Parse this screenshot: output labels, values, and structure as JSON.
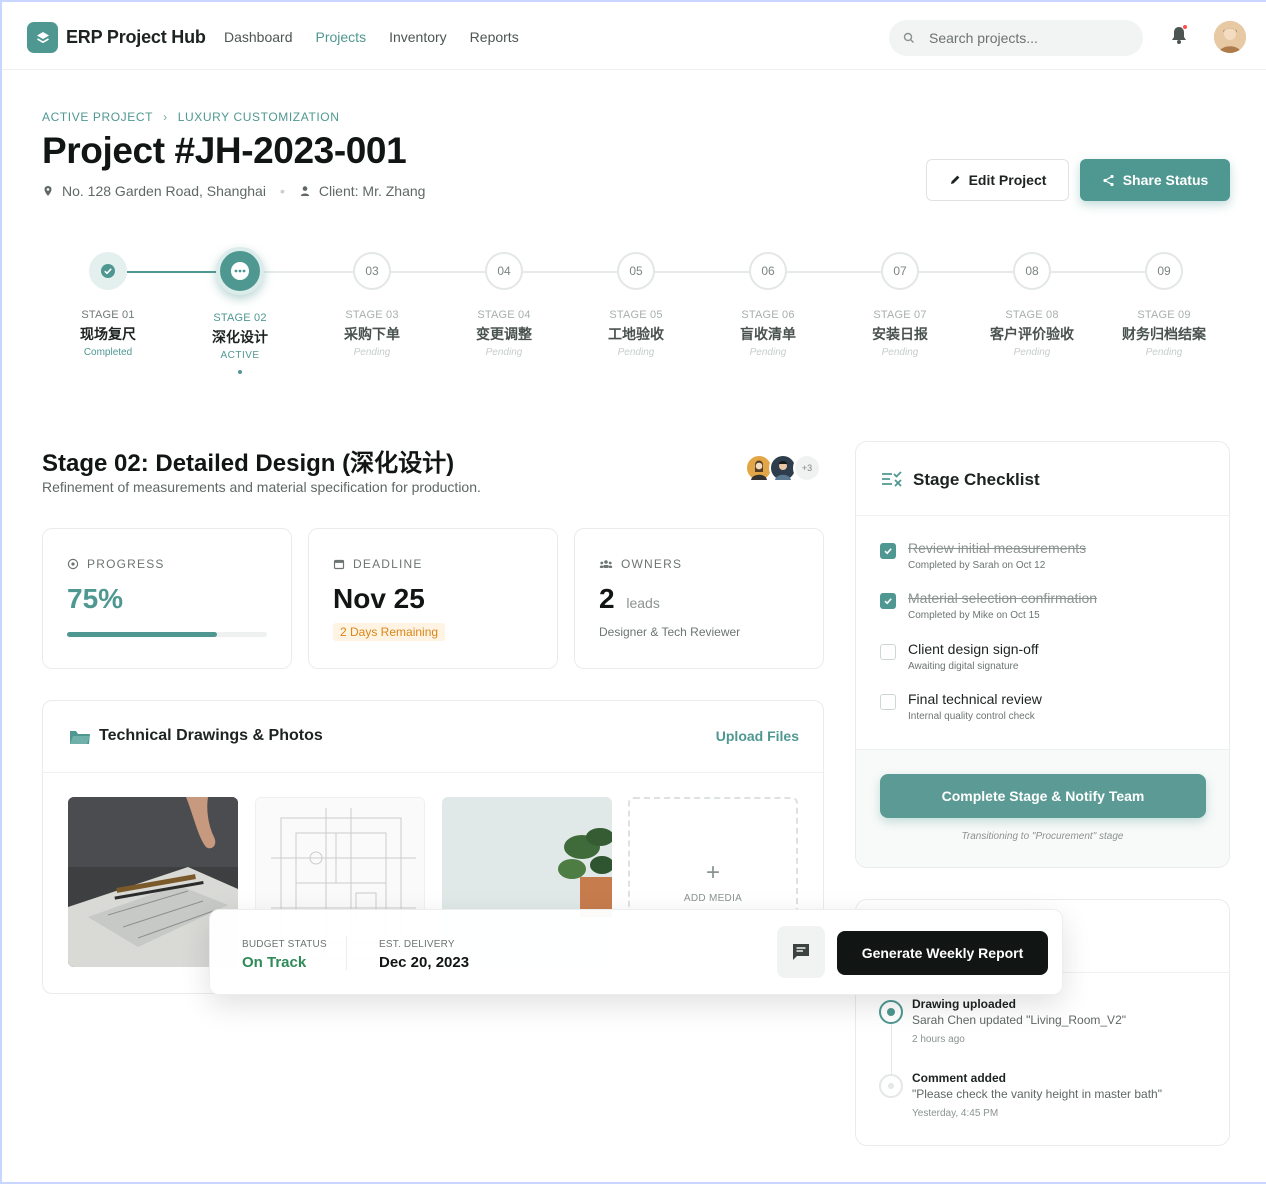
{
  "header": {
    "app_title": "ERP Project Hub",
    "nav": [
      "Dashboard",
      "Projects",
      "Inventory",
      "Reports"
    ],
    "active_nav": "Projects",
    "search_placeholder": "Search projects..."
  },
  "breadcrumb": [
    "ACTIVE PROJECT",
    "LUXURY CUSTOMIZATION"
  ],
  "project": {
    "title": "Project #JH-2023-001",
    "address": "No. 128 Garden Road, Shanghai",
    "client": "Client: Mr. Zhang",
    "edit_label": "Edit Project",
    "share_label": "Share Status"
  },
  "stages": [
    {
      "num": "01",
      "stage": "STAGE 01",
      "name": "现场复尺",
      "status": "Completed",
      "state": "done"
    },
    {
      "num": "02",
      "stage": "STAGE 02",
      "name": "深化设计",
      "status": "ACTIVE",
      "state": "active"
    },
    {
      "num": "03",
      "stage": "STAGE 03",
      "name": "采购下单",
      "status": "Pending",
      "state": "pending"
    },
    {
      "num": "04",
      "stage": "STAGE 04",
      "name": "变更调整",
      "status": "Pending",
      "state": "pending"
    },
    {
      "num": "05",
      "stage": "STAGE 05",
      "name": "工地验收",
      "status": "Pending",
      "state": "pending"
    },
    {
      "num": "06",
      "stage": "STAGE 06",
      "name": "盲收清单",
      "status": "Pending",
      "state": "pending"
    },
    {
      "num": "07",
      "stage": "STAGE 07",
      "name": "安装日报",
      "status": "Pending",
      "state": "pending"
    },
    {
      "num": "08",
      "stage": "STAGE 08",
      "name": "客户评价验收",
      "status": "Pending",
      "state": "pending"
    },
    {
      "num": "09",
      "stage": "STAGE 09",
      "name": "财务归档结案",
      "status": "Pending",
      "state": "pending"
    }
  ],
  "stage_detail": {
    "title": "Stage 02: Detailed Design (深化设计)",
    "subtitle": "Refinement of measurements and material specification for production.",
    "extra_owners": "+3"
  },
  "kpis": {
    "progress": {
      "label": "PROGRESS",
      "value": "75%",
      "fraction": 0.75
    },
    "deadline": {
      "label": "DEADLINE",
      "value": "Nov 25",
      "badge": "2 Days Remaining"
    },
    "owners": {
      "label": "OWNERS",
      "value": "2",
      "unit": "leads",
      "note": "Designer & Tech Reviewer"
    }
  },
  "media": {
    "title": "Technical Drawings & Photos",
    "upload_label": "Upload Files",
    "add_label": "ADD MEDIA"
  },
  "floating_bar": {
    "budget_label": "BUDGET STATUS",
    "budget_value": "On Track",
    "delivery_label": "EST. DELIVERY",
    "delivery_value": "Dec 20, 2023",
    "report_label": "Generate Weekly Report"
  },
  "checklist": {
    "title": "Stage Checklist",
    "items": [
      {
        "title": "Review initial measurements",
        "sub": "Completed by Sarah on Oct 12",
        "checked": true
      },
      {
        "title": "Material selection confirmation",
        "sub": "Completed by Mike on Oct 15",
        "checked": true
      },
      {
        "title": "Client design sign-off",
        "sub": "Awaiting digital signature",
        "checked": false
      },
      {
        "title": "Final technical review",
        "sub": "Internal quality control check",
        "checked": false
      }
    ],
    "button_label": "Complete Stage & Notify Team",
    "note": "Transitioning to \"Procurement\" stage"
  },
  "activity": [
    {
      "title": "Drawing uploaded",
      "desc": "Sarah Chen updated \"Living_Room_V2\"",
      "time": "2 hours ago"
    },
    {
      "title": "Comment added",
      "desc": "\"Please check the vanity height in master bath\"",
      "time": "Yesterday, 4:45 PM"
    }
  ],
  "colors": {
    "accent": "#4f9891",
    "warning": "#d98618",
    "success": "#2e8b57",
    "dark": "#111614"
  }
}
